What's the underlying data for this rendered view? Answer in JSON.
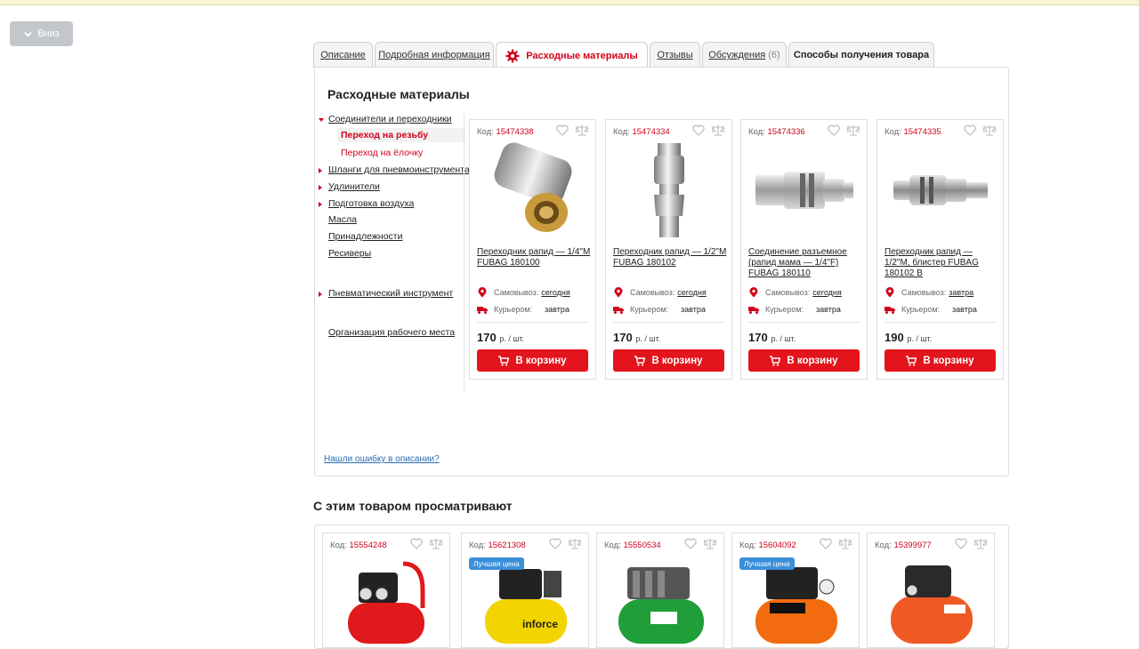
{
  "down_button": {
    "label": "Вниз"
  },
  "tabs": [
    {
      "label": "Описание"
    },
    {
      "label": "Подробная информация"
    },
    {
      "label": "Расходные материалы"
    },
    {
      "label": "Отзывы"
    },
    {
      "label": "Обсуждения",
      "count": "(6)"
    },
    {
      "label": "Способы получения товара"
    }
  ],
  "panel": {
    "title": "Расходные материалы",
    "error_link": "Нашли ошибку в описании?"
  },
  "categories": [
    {
      "label": "Соединители и переходники"
    },
    {
      "label": "Переход на резьбу"
    },
    {
      "label": "Переход на ёлочку"
    },
    {
      "label": "Шланги для пневмоинструмента"
    },
    {
      "label": "Удлинители"
    },
    {
      "label": "Подготовка воздуха"
    },
    {
      "label": "Масла"
    },
    {
      "label": "Принадлежности"
    },
    {
      "label": "Ресиверы"
    },
    {
      "label": "Пневматический инструмент"
    },
    {
      "label": "Организация рабочего места"
    }
  ],
  "common": {
    "code_label": "Код:",
    "pickup_label": "Самовывоз:",
    "courier_label": "Курьером:",
    "price_unit": "р. / шт.",
    "cart_label": "В корзину"
  },
  "products": [
    {
      "code": "15474338",
      "name": "Переходник рапид — 1/4\"M FUBAG 180100",
      "pickup": "сегодня",
      "courier": "завтра",
      "price": "170"
    },
    {
      "code": "15474334",
      "name": "Переходник рапид — 1/2\"M FUBAG 180102",
      "pickup": "сегодня",
      "courier": "завтра",
      "price": "170"
    },
    {
      "code": "15474336",
      "name": "Соединение разъемное (рапид мама — 1/4\"F) FUBAG 180110",
      "pickup": "сегодня",
      "courier": "завтра",
      "price": "170"
    },
    {
      "code": "15474335",
      "name": "Переходник рапид — 1/2\"M, блистер FUBAG 180102 B",
      "pickup": "завтра",
      "courier": "завтра",
      "price": "190"
    }
  ],
  "also_viewed": {
    "title": "С этим товаром просматривают",
    "items": [
      {
        "code": "15554248",
        "badge": ""
      },
      {
        "code": "15621308",
        "badge": "Лучшая цена"
      },
      {
        "code": "15550534",
        "badge": ""
      },
      {
        "code": "15604092",
        "badge": "Лучшая цена"
      },
      {
        "code": "15399977",
        "badge": ""
      }
    ]
  },
  "colors": {
    "accent": "#e3141b",
    "link": "#2b6cb0",
    "badge": "#3b8fd9"
  }
}
